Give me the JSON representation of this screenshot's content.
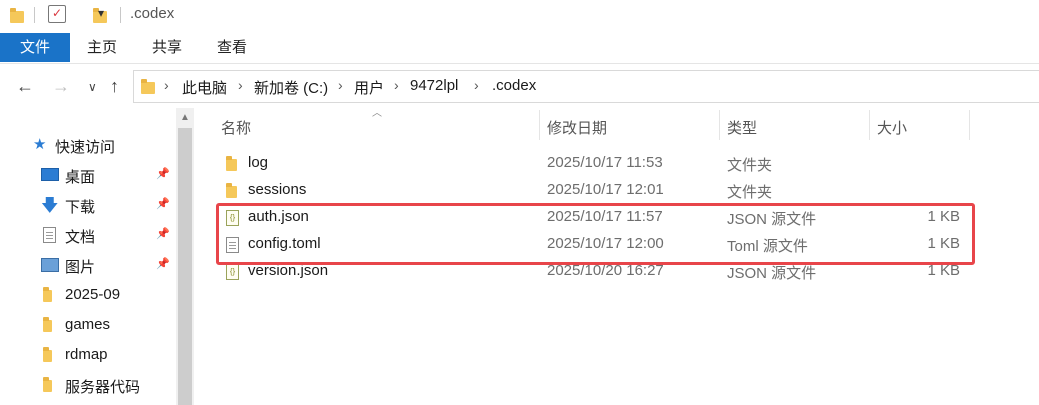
{
  "titlebar": {
    "title": ".codex",
    "dropdown_glyph": "▾"
  },
  "ribbon": {
    "tabs": [
      "文件",
      "主页",
      "共享",
      "查看"
    ]
  },
  "nav": {
    "back": "←",
    "forward": "→",
    "recent": "∨",
    "up": "↑"
  },
  "address": {
    "crumbs": [
      "此电脑",
      "新加卷 (C:)",
      "用户",
      "9472lpl",
      ".codex"
    ]
  },
  "sidebar": {
    "quick_access": "快速访问",
    "items": [
      {
        "label": "桌面",
        "icon": "desktop-icon",
        "pinned": true
      },
      {
        "label": "下载",
        "icon": "download-icon",
        "pinned": true
      },
      {
        "label": "文档",
        "icon": "document-icon",
        "pinned": true
      },
      {
        "label": "图片",
        "icon": "picture-icon",
        "pinned": true
      },
      {
        "label": "2025-09",
        "icon": "folder-icon",
        "pinned": false
      },
      {
        "label": "games",
        "icon": "folder-icon",
        "pinned": false
      },
      {
        "label": "rdmap",
        "icon": "folder-icon",
        "pinned": false
      },
      {
        "label": "服务器代码",
        "icon": "folder-icon",
        "pinned": false
      }
    ]
  },
  "columns": {
    "name": "名称",
    "modified": "修改日期",
    "type": "类型",
    "size": "大小"
  },
  "files": [
    {
      "name": "log",
      "modified": "2025/10/17 11:53",
      "type": "文件夹",
      "size": "",
      "icon": "folder-icon"
    },
    {
      "name": "sessions",
      "modified": "2025/10/17 12:01",
      "type": "文件夹",
      "size": "",
      "icon": "folder-icon"
    },
    {
      "name": "auth.json",
      "modified": "2025/10/17 11:57",
      "type": "JSON 源文件",
      "size": "1 KB",
      "icon": "json-file-icon"
    },
    {
      "name": "config.toml",
      "modified": "2025/10/17 12:00",
      "type": "Toml 源文件",
      "size": "1 KB",
      "icon": "text-file-icon"
    },
    {
      "name": "version.json",
      "modified": "2025/10/20 16:27",
      "type": "JSON 源文件",
      "size": "1 KB",
      "icon": "json-file-icon"
    }
  ],
  "colors": {
    "accent": "#1a73c8",
    "highlight": "#e8454a",
    "folder": "#f5c85a"
  }
}
